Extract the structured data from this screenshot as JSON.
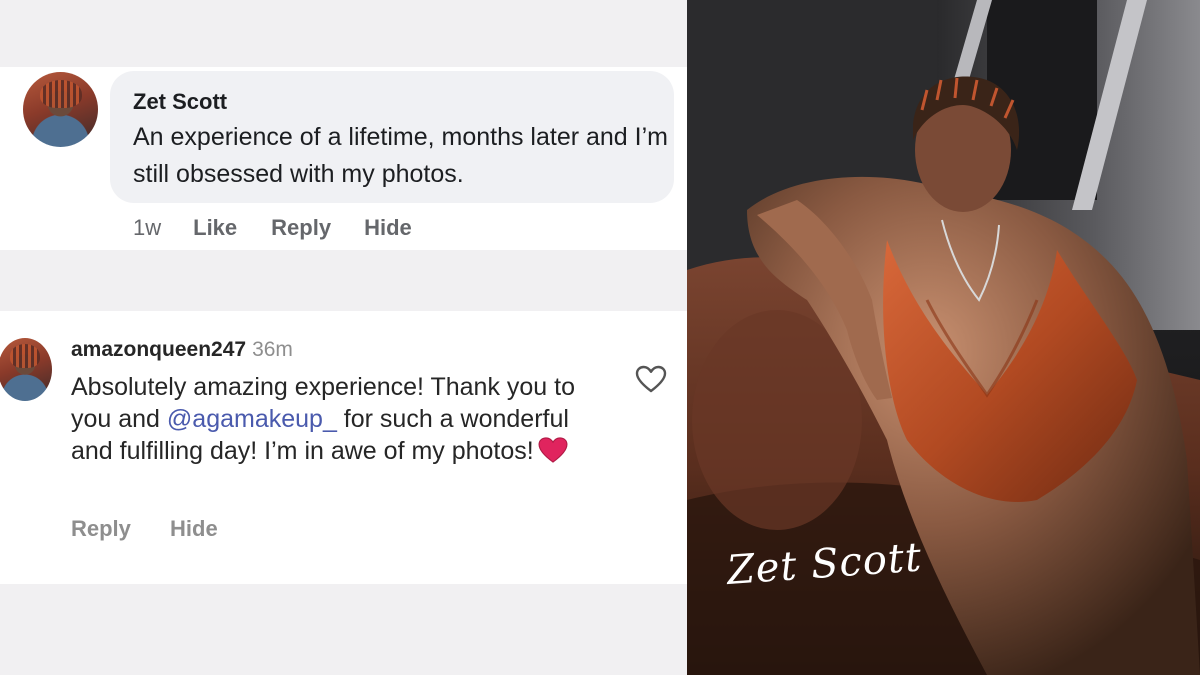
{
  "facebook_comment": {
    "author": "Zet Scott",
    "text": "An experience of a lifetime, months later and I’m still obsessed with my photos.",
    "time": "1w",
    "like_label": "Like",
    "reply_label": "Reply",
    "hide_label": "Hide"
  },
  "instagram_comment": {
    "username": "amazonqueen247",
    "time": "36m",
    "text_before": "Absolutely amazing experience! Thank you to you and ",
    "mention": "@agamakeup_",
    "text_after": " for such a wonderful and fulfilling day! I’m in awe of my photos!",
    "emoji": "red-heart",
    "like_icon": "heart-outline-icon",
    "reply_label": "Reply",
    "hide_label": "Hide"
  },
  "photo": {
    "signature": "Zet Scott"
  },
  "colors": {
    "mention": "#4a5aad",
    "heart": "#e0245e",
    "dress": "#c2552a",
    "couch": "#6b3a26"
  }
}
